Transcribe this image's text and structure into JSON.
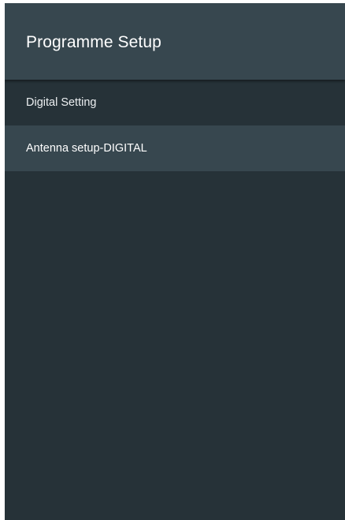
{
  "header": {
    "title": "Programme Setup"
  },
  "menu": {
    "items": [
      {
        "label": "Digital Setting",
        "selected": false
      },
      {
        "label": "Antenna setup-DIGITAL",
        "selected": true
      }
    ]
  },
  "colors": {
    "background": "#263238",
    "header": "#37474f",
    "selected_item": "#37474f",
    "text": "#eceff1"
  }
}
